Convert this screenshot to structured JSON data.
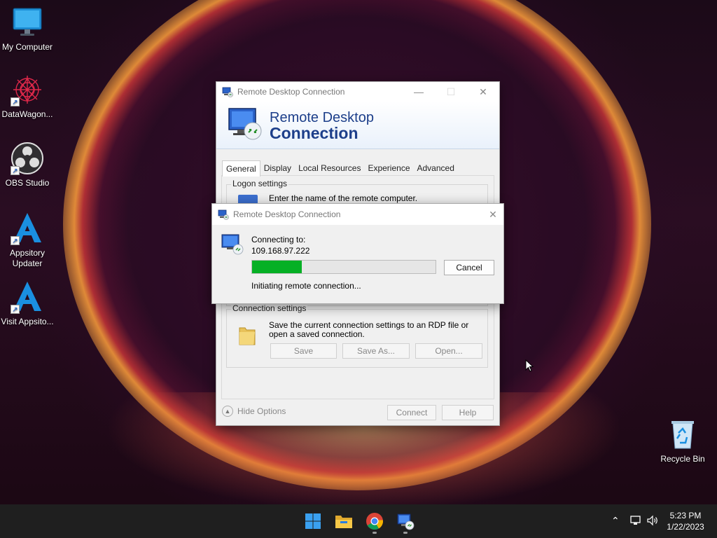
{
  "desktop": {
    "icons": [
      {
        "label": "My Computer"
      },
      {
        "label": "DataWagon..."
      },
      {
        "label": "OBS Studio"
      },
      {
        "label": "Appsitory Updater"
      },
      {
        "label": "Visit Appsito..."
      },
      {
        "label": "Recycle Bin"
      }
    ]
  },
  "rdc_window": {
    "title": "Remote Desktop Connection",
    "banner_line1": "Remote Desktop",
    "banner_line2": "Connection",
    "tabs": [
      {
        "label": "General",
        "active": true
      },
      {
        "label": "Display"
      },
      {
        "label": "Local Resources"
      },
      {
        "label": "Experience"
      },
      {
        "label": "Advanced"
      }
    ],
    "logon_settings": {
      "title": "Logon settings",
      "text": "Enter the name of the remote computer."
    },
    "connection_settings": {
      "title": "Connection settings",
      "text": "Save the current connection settings to an RDP file or open a saved connection.",
      "save_label": "Save",
      "save_as_label": "Save As...",
      "open_label": "Open..."
    },
    "hide_options_label": "Hide Options",
    "connect_label": "Connect",
    "help_label": "Help"
  },
  "connecting_dialog": {
    "title": "Remote Desktop Connection",
    "connecting_to_label": "Connecting to:",
    "address": "109.168.97.222",
    "progress": 0.27,
    "cancel_label": "Cancel",
    "status": "Initiating remote connection..."
  },
  "taskbar": {
    "apps": [
      {
        "icon": "windows-start-icon"
      },
      {
        "icon": "file-explorer-icon"
      },
      {
        "icon": "chrome-icon"
      },
      {
        "icon": "remote-desktop-icon"
      }
    ],
    "time": "5:23 PM",
    "date": "1/22/2023"
  },
  "colors": {
    "accent_blue": "#1d3f8a",
    "progress_green": "#06b025",
    "taskbar_bg": "#1f1f1f"
  }
}
